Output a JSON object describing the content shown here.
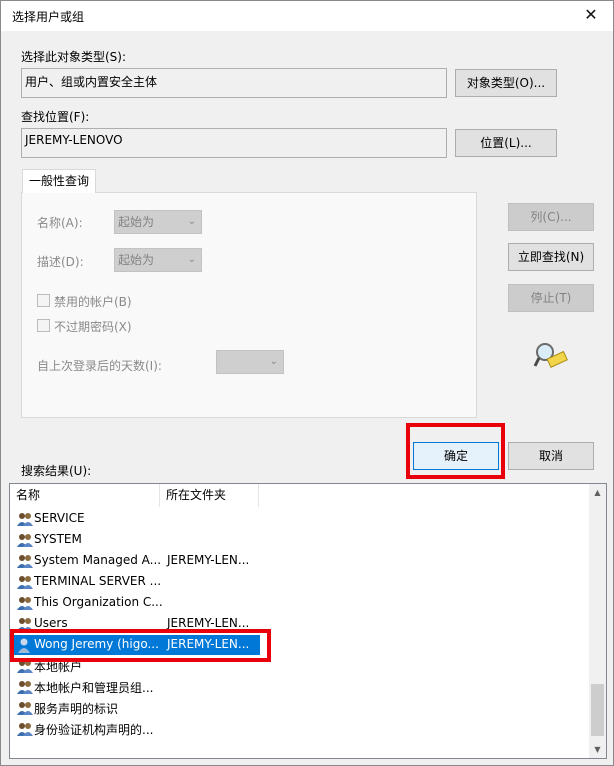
{
  "window": {
    "title": "选择用户或组",
    "close_glyph": "✕"
  },
  "object_type": {
    "label": "选择此对象类型(S):",
    "value": "用户、组或内置安全主体",
    "button": "对象类型(O)..."
  },
  "location": {
    "label": "查找位置(F):",
    "value": "JEREMY-LENOVO",
    "button": "位置(L)..."
  },
  "tab": {
    "label": "一般性查询"
  },
  "query": {
    "name_label": "名称(A):",
    "name_combo": "起始为",
    "desc_label": "描述(D):",
    "desc_combo": "起始为",
    "disabled_accounts": "禁用的帐户(B)",
    "no_expire_password": "不过期密码(X)",
    "days_since_login": "自上次登录后的天数(I):"
  },
  "side_buttons": {
    "columns": "列(C)...",
    "find_now": "立即查找(N)",
    "stop": "停止(T)"
  },
  "dialog_buttons": {
    "ok": "确定",
    "cancel": "取消"
  },
  "results": {
    "label": "搜索结果(U):",
    "columns": [
      "名称",
      "所在文件夹"
    ],
    "rows": [
      {
        "name": "SERVICE",
        "folder": "",
        "icon": "group-icon"
      },
      {
        "name": "SYSTEM",
        "folder": "",
        "icon": "group-icon"
      },
      {
        "name": "System Managed A...",
        "folder": "JEREMY-LEN...",
        "icon": "group-icon"
      },
      {
        "name": "TERMINAL SERVER ...",
        "folder": "",
        "icon": "group-icon"
      },
      {
        "name": "This Organization C...",
        "folder": "",
        "icon": "group-icon"
      },
      {
        "name": "Users",
        "folder": "JEREMY-LEN...",
        "icon": "group-icon"
      },
      {
        "name": "Wong Jeremy (higo...",
        "folder": "JEREMY-LEN...",
        "icon": "user-icon",
        "selected": true
      },
      {
        "name": "本地帐户",
        "folder": "",
        "icon": "group-icon"
      },
      {
        "name": "本地帐户和管理员组...",
        "folder": "",
        "icon": "group-icon"
      },
      {
        "name": "服务声明的标识",
        "folder": "",
        "icon": "group-icon"
      },
      {
        "name": "身份验证机构声明的...",
        "folder": "",
        "icon": "group-icon"
      }
    ]
  },
  "colors": {
    "accent": "#0078d7",
    "highlight_box": "#e8000b"
  }
}
